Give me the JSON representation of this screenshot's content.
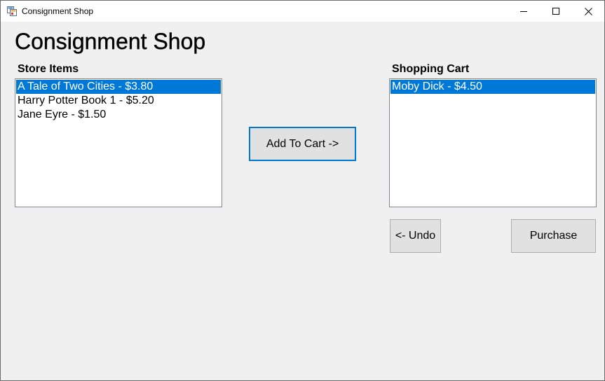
{
  "window": {
    "title": "Consignment Shop",
    "controls": {
      "minimize_icon": "minimize-icon",
      "maximize_icon": "maximize-icon",
      "close_icon": "close-icon"
    }
  },
  "main": {
    "heading": "Consignment Shop",
    "store": {
      "label": "Store Items",
      "items": [
        {
          "text": "A Tale of Two Cities - $3.80",
          "selected": true
        },
        {
          "text": "Harry Potter Book 1 - $5.20",
          "selected": false
        },
        {
          "text": "Jane Eyre - $1.50",
          "selected": false
        }
      ]
    },
    "cart": {
      "label": "Shopping Cart",
      "items": [
        {
          "text": "Moby Dick - $4.50",
          "selected": true
        }
      ]
    },
    "buttons": {
      "add_to_cart": "Add To Cart ->",
      "undo": "<- Undo",
      "purchase": "Purchase"
    }
  },
  "colors": {
    "selection": "#0078d7",
    "window_bg": "#f0f0f0",
    "button_bg": "#e1e1e1"
  }
}
